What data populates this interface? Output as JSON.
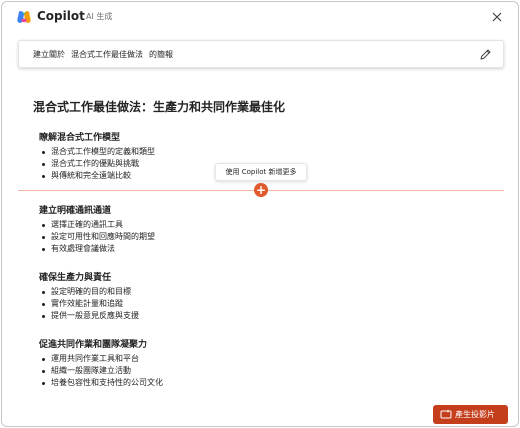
{
  "header": {
    "app_name": "Copilot",
    "app_tag": "AI 生成",
    "logo_icon": "copilot-logo-icon",
    "close_icon": "close-icon"
  },
  "prompt": {
    "parts": [
      "建立關於",
      "混合式工作最佳做法",
      "的簡報"
    ],
    "edit_icon": "pencil-icon"
  },
  "document": {
    "title": "混合式工作最佳做法：生產力和共同作業最佳化",
    "sections": [
      {
        "heading": "瞭解混合式工作模型",
        "items": [
          "混合式工作模型的定義和類型",
          "混合式工作的優點與挑戰",
          "與傳統和完全遠端比較"
        ]
      },
      {
        "heading": "建立明確通訊通道",
        "items": [
          "選擇正確的通訊工具",
          "設定可用性和回應時間的期望",
          "有效處理會議做法"
        ]
      },
      {
        "heading": "確保生產力與責任",
        "items": [
          "設定明確的目的和目標",
          "實作效能計量和追蹤",
          "提供一般意見反應與支援"
        ]
      },
      {
        "heading": "促進共同作業和團隊凝聚力",
        "items": [
          "運用共同作業工具和平台",
          "組織一般團隊建立活動",
          "培養包容性和支持性的公司文化"
        ]
      }
    ]
  },
  "insert": {
    "tooltip": "使用 Copilot 新增更多",
    "button_label": "+",
    "accent_color": "#e05a2b",
    "line_color": "#f4b7a4"
  },
  "footer": {
    "generate_label": "產生投影片",
    "generate_icon": "slides-icon",
    "button_color": "#c43e1c"
  }
}
